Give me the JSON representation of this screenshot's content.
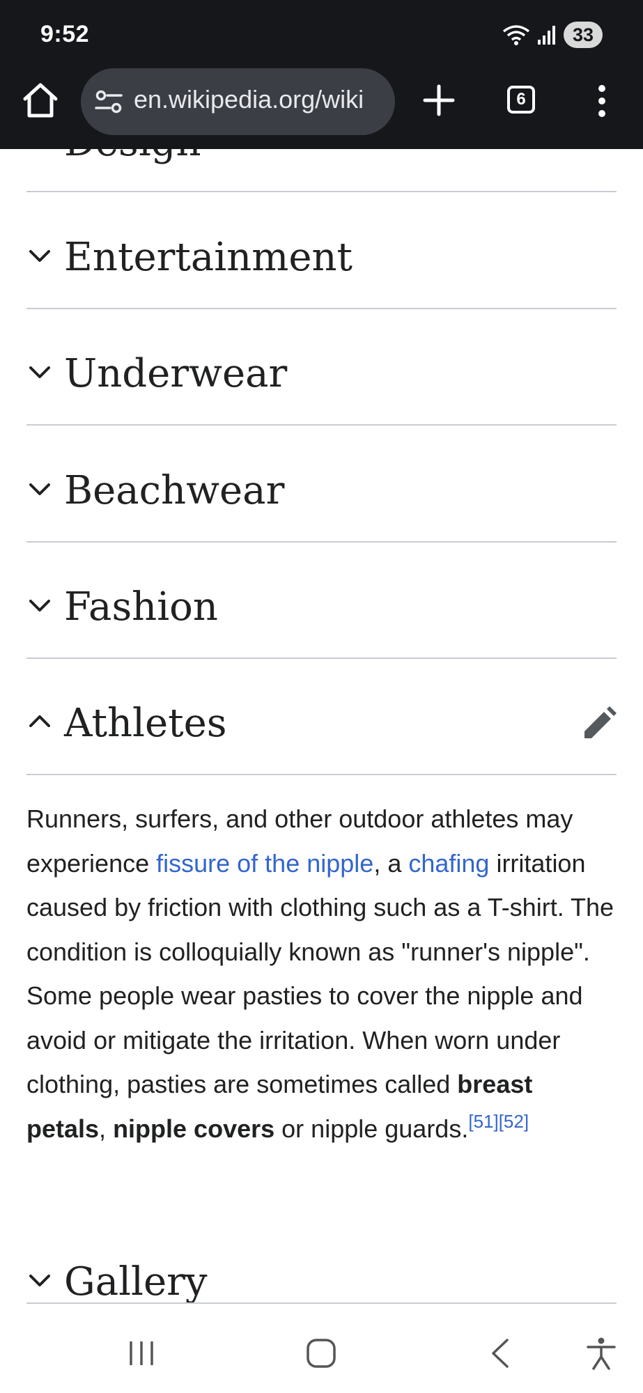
{
  "status_bar": {
    "time": "9:52",
    "battery": "33",
    "icons": [
      "wifi-icon",
      "signal-icon",
      "battery-icon"
    ]
  },
  "browser": {
    "url": "en.wikipedia.org/wiki",
    "tab_count": "6",
    "icons": [
      "home-icon",
      "site-settings-icon",
      "plus-icon",
      "tabs-icon",
      "more-vert-icon"
    ]
  },
  "article": {
    "partial_heading": "Design",
    "sections": [
      {
        "title": "Entertainment",
        "expanded": false
      },
      {
        "title": "Underwear",
        "expanded": false
      },
      {
        "title": "Beachwear",
        "expanded": false
      },
      {
        "title": "Fashion",
        "expanded": false
      },
      {
        "title": "Athletes",
        "expanded": true
      },
      {
        "title": "Gallery",
        "expanded": false
      }
    ],
    "athletes_paragraph": {
      "part1": "Runners, surfers, and other outdoor athletes may experience ",
      "link1": "fissure of the nipple",
      "part2": ", a ",
      "link2": "chafing",
      "part3": " irritation caused by friction with clothing such as a T-shirt. The condition is colloquially known as \"runner's nipple\". Some people wear pasties to cover the nipple and avoid or mitigate the irritation. When worn under clothing, pasties are sometimes called ",
      "bold1": "breast petals",
      "part4": ", ",
      "bold2": "nipple covers",
      "part5": " or nipple guards.",
      "refs": "[51][52]"
    }
  },
  "colors": {
    "link": "#3366cc",
    "text": "#202122",
    "divider": "#c8ccd1",
    "toolbar_bg": "#16171b"
  },
  "nav_bar": {
    "icons": [
      "recent-apps-icon",
      "home-nav-icon",
      "back-icon",
      "accessibility-icon"
    ]
  }
}
